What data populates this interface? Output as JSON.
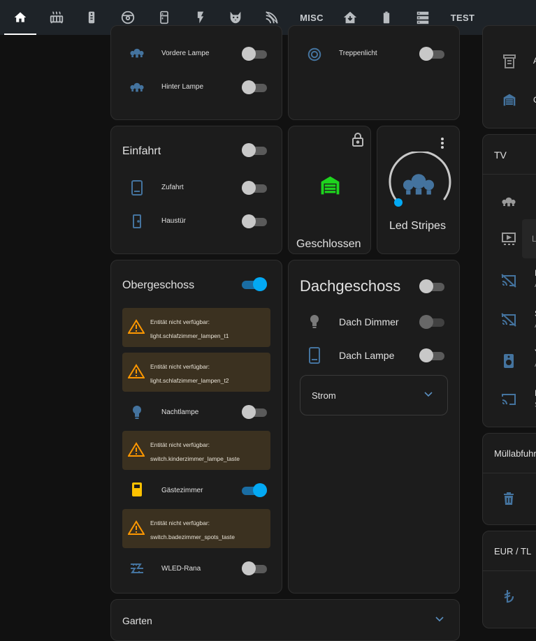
{
  "colors": {
    "accent": "#03a9f4",
    "warning": "#ff9800",
    "garage": "#1ed51e",
    "icon_blue": "#44739e",
    "gold": "#fdc100"
  },
  "tabs": [
    {
      "icon": "home-icon"
    },
    {
      "icon": "radiator-icon"
    },
    {
      "icon": "remote-icon"
    },
    {
      "icon": "robot-vacuum-icon"
    },
    {
      "icon": "fridge-icon"
    },
    {
      "icon": "flash-icon"
    },
    {
      "icon": "cat-icon"
    },
    {
      "icon": "wifi-strength-icon"
    },
    {
      "label": "MISC"
    },
    {
      "icon": "home-import-icon"
    },
    {
      "icon": "battery-icon"
    },
    {
      "icon": "server-icon"
    },
    {
      "label": "TEST"
    }
  ],
  "lamps_card": {
    "items": [
      {
        "label": "Vordere Lampe"
      },
      {
        "label": "Hinter Lampe"
      }
    ]
  },
  "stairs_card": {
    "items": [
      {
        "label": "Treppenlicht"
      }
    ]
  },
  "einfahrt": {
    "title": "Einfahrt",
    "items": [
      {
        "label": "Zufahrt"
      },
      {
        "label": "Haustür"
      }
    ]
  },
  "garage": {
    "state": "Geschlossen"
  },
  "led": {
    "name": "Led Stripes"
  },
  "obergeschoss": {
    "title": "Obergeschoss",
    "warnings": [
      {
        "line1": "Entität nicht verfügbar:",
        "line2": "light.schlafzimmer_lampen_t1"
      },
      {
        "line1": "Entität nicht verfügbar:",
        "line2": "light.schlafzimmer_lampen_t2"
      },
      {
        "line1": "Entität nicht verfügbar:",
        "line2": "switch.kinderzimmer_lampe_taste"
      },
      {
        "line1": "Entität nicht verfügbar:",
        "line2": "switch.badezimmer_spots_taste"
      }
    ],
    "items": [
      {
        "label": "Nachtlampe"
      },
      {
        "label": "Gästezimmer"
      },
      {
        "label": "WLED-Rana"
      }
    ]
  },
  "dachgeschoss": {
    "title": "Dachgeschoss",
    "items": [
      {
        "label": "Dach Dimmer"
      },
      {
        "label": "Dach Lampe"
      }
    ],
    "expander": "Strom"
  },
  "garten": {
    "title": "Garten"
  },
  "right": {
    "tv_title": "TV",
    "tv_partial": [
      "L",
      "I",
      "A",
      "S",
      "A",
      "Y",
      "A",
      "I",
      "S"
    ],
    "muell_title": "Müllabfuhr",
    "eur_title": "EUR / TL",
    "top_partial": [
      "A",
      "C"
    ]
  }
}
